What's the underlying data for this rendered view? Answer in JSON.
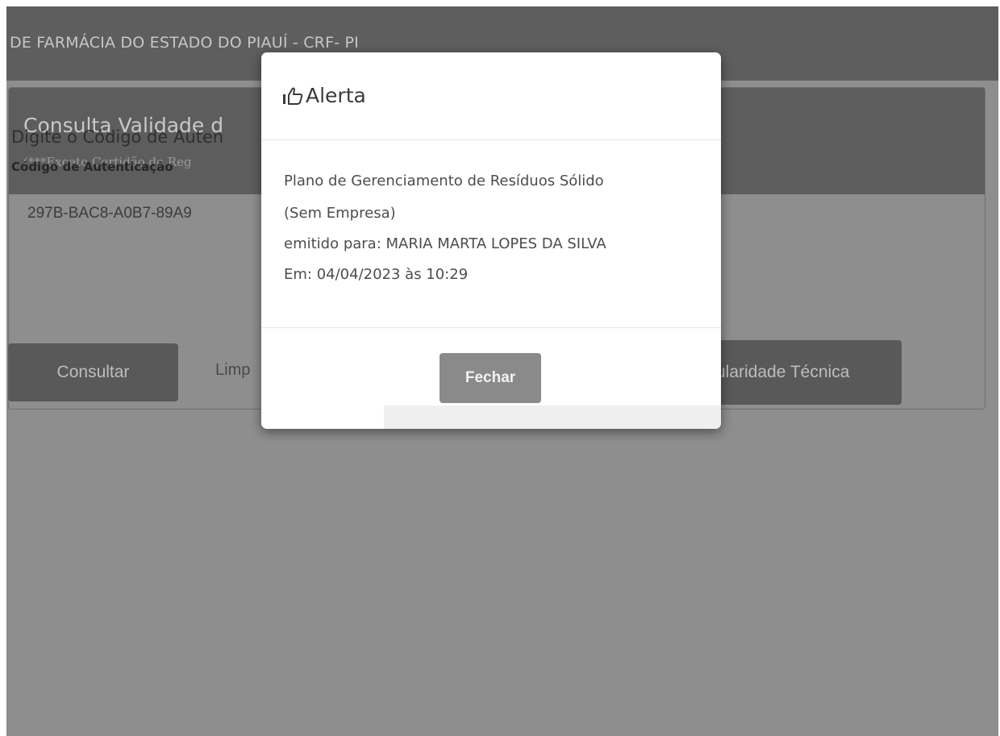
{
  "header": {
    "title": "DE FARMÁCIA DO ESTADO DO PIAUÍ - CRF- PI"
  },
  "panel": {
    "title": "Consulta Validade d",
    "subtitle": "(***Exceto Certidão de Reg",
    "prompt": "Digite o Código de Auten",
    "code_label": "Código de Autenticação",
    "code_value": "297B-BAC8-A0B7-89A9",
    "consultar_label": "Consultar",
    "limpar_label": "Limp",
    "regularidade_label": "ularidade Técnica"
  },
  "modal": {
    "icon": "thumbs-up-icon",
    "title": "Alerta",
    "line1": "Plano de Gerenciamento de Resíduos Sólido",
    "line2": "(Sem Empresa)",
    "line3": "emitido para: MARIA MARTA LOPES DA SILVA",
    "line4": "Em: 04/04/2023 às 10:29",
    "close_label": "Fechar"
  },
  "colors": {
    "overlay": "#8e8e8e",
    "header_dark": "#5e5e5e",
    "button_dark": "#595959",
    "close_button": "#8a8a8a"
  }
}
